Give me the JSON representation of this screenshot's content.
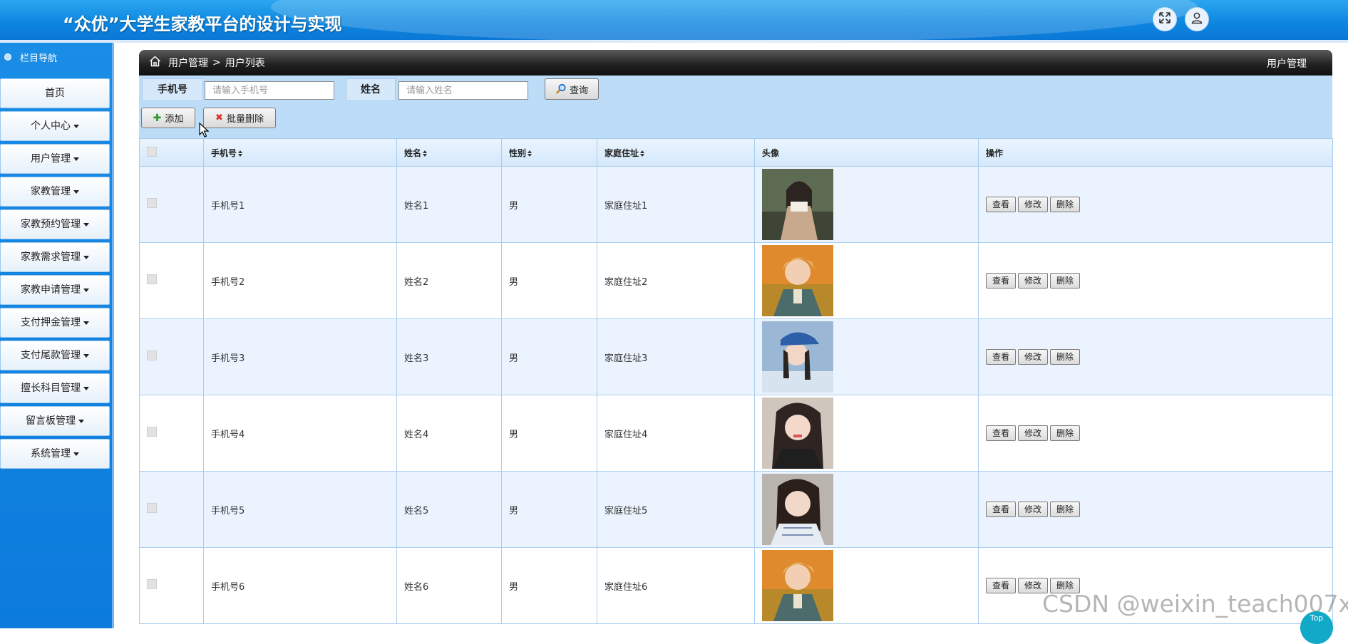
{
  "header": {
    "title": "“众优”大学生家教平台的设计与实现",
    "fullscreen_icon": "expand-icon",
    "user_icon": "user-icon"
  },
  "sidebar": {
    "heading": "栏目导航",
    "items": [
      {
        "label": "首页",
        "dropdown": false
      },
      {
        "label": "个人中心",
        "dropdown": true
      },
      {
        "label": "用户管理",
        "dropdown": true
      },
      {
        "label": "家教管理",
        "dropdown": true
      },
      {
        "label": "家教预约管理",
        "dropdown": true
      },
      {
        "label": "家教需求管理",
        "dropdown": true
      },
      {
        "label": "家教申请管理",
        "dropdown": true
      },
      {
        "label": "支付押金管理",
        "dropdown": true
      },
      {
        "label": "支付尾款管理",
        "dropdown": true
      },
      {
        "label": "擅长科目管理",
        "dropdown": true
      },
      {
        "label": "留言板管理",
        "dropdown": true
      },
      {
        "label": "系统管理",
        "dropdown": true
      }
    ]
  },
  "topbar": {
    "breadcrumb_1": "用户管理",
    "separator": ">",
    "breadcrumb_2": "用户列表",
    "section_title": "用户管理"
  },
  "search": {
    "phone_label": "手机号",
    "phone_placeholder": "请输入手机号",
    "phone_value": "",
    "name_label": "姓名",
    "name_placeholder": "请输入姓名",
    "name_value": "",
    "query_button": "查询"
  },
  "actions": {
    "add_button": "添加",
    "batch_delete_button": "批量删除"
  },
  "table": {
    "columns": [
      "手机号",
      "姓名",
      "性别",
      "家庭住址",
      "头像",
      "操作"
    ],
    "row_buttons": {
      "view": "查看",
      "edit": "修改",
      "delete": "删除"
    },
    "rows": [
      {
        "phone": "手机号1",
        "name": "姓名1",
        "gender": "男",
        "address": "家庭住址1"
      },
      {
        "phone": "手机号2",
        "name": "姓名2",
        "gender": "男",
        "address": "家庭住址2"
      },
      {
        "phone": "手机号3",
        "name": "姓名3",
        "gender": "男",
        "address": "家庭住址3"
      },
      {
        "phone": "手机号4",
        "name": "姓名4",
        "gender": "男",
        "address": "家庭住址4"
      },
      {
        "phone": "手机号5",
        "name": "姓名5",
        "gender": "男",
        "address": "家庭住址5"
      },
      {
        "phone": "手机号6",
        "name": "姓名6",
        "gender": "男",
        "address": "家庭住址6"
      }
    ]
  },
  "watermark": "CSDN @weixin_teach007x",
  "back_to_top": "Top",
  "colors": {
    "header_blue": "#0d86e0",
    "sidebar_blue": "#0c7bdc",
    "search_zone": "#bcdcf8",
    "row_alt": "#ebf4fe"
  }
}
